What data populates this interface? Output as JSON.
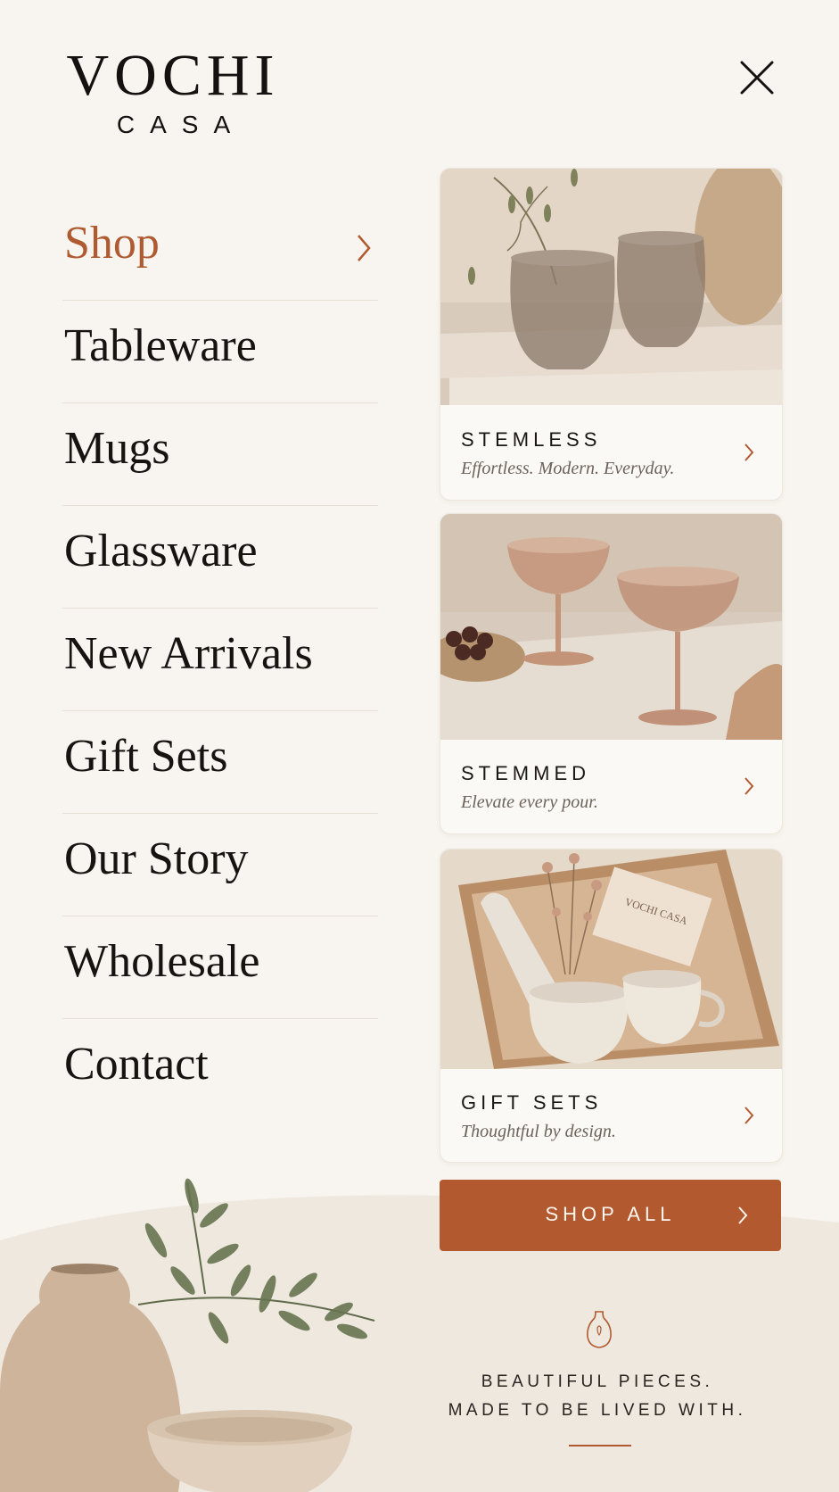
{
  "brand": {
    "name": "VOCHI",
    "subname": "CASA"
  },
  "header": {
    "close_icon": "close-icon"
  },
  "nav": {
    "items": [
      {
        "label": "Shop",
        "active": true,
        "icon": "chevron-right-icon"
      },
      {
        "label": "Tableware"
      },
      {
        "label": "Mugs"
      },
      {
        "label": "Glassware"
      },
      {
        "label": "New Arrivals"
      },
      {
        "label": "Gift Sets"
      },
      {
        "label": "Our Story"
      },
      {
        "label": "Wholesale"
      },
      {
        "label": "Contact"
      }
    ]
  },
  "cards": [
    {
      "title": "STEMLESS",
      "tagline": "Effortless. Modern. Everyday."
    },
    {
      "title": "STEMMED",
      "tagline": "Elevate every pour."
    },
    {
      "title": "GIFT SETS",
      "tagline": "Thoughtful by design.",
      "card_text": "VOCHI CASA"
    }
  ],
  "cta": {
    "label": "SHOP ALL"
  },
  "footer": {
    "line1": "BEAUTIFUL PIECES.",
    "line2": "MADE TO BE LIVED WITH.",
    "icon": "vase-icon"
  },
  "colors": {
    "accent": "#b05a32",
    "background": "#f8f5f0",
    "button": "#b3592f",
    "text": "#171310"
  }
}
